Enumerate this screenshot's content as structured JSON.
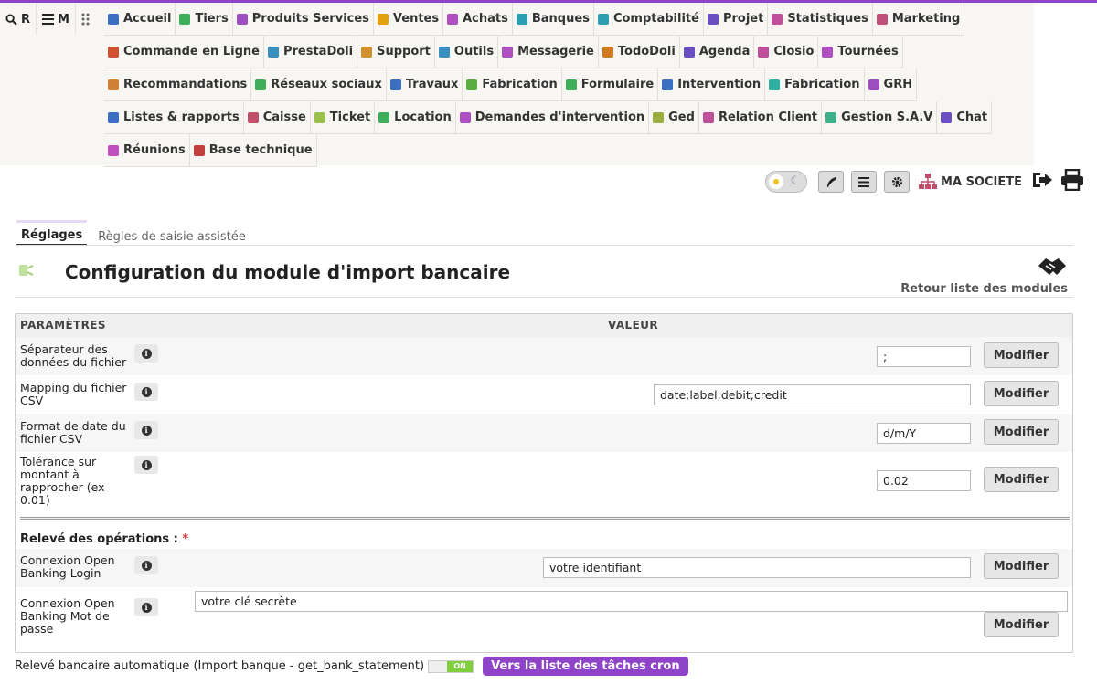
{
  "left_controls": [
    {
      "icon": "search-icon",
      "label": "R"
    },
    {
      "icon": "hamburger-icon",
      "label": "M"
    },
    {
      "icon": "grid-icon",
      "label": ""
    }
  ],
  "menu_rows": [
    [
      {
        "label": "Accueil",
        "icon": "home-icon",
        "color": "#3a6fc1"
      },
      {
        "label": "Tiers",
        "icon": "building-icon",
        "color": "#3fae5a"
      },
      {
        "label": "Produits Services",
        "icon": "cubes-icon",
        "color": "#9b4fc0"
      },
      {
        "label": "Ventes",
        "icon": "euro-icon",
        "color": "#e0a20f"
      },
      {
        "label": "Achats",
        "icon": "coins-icon",
        "color": "#b04fc0"
      },
      {
        "label": "Banques",
        "icon": "bank-icon",
        "color": "#2c9fb0"
      },
      {
        "label": "Comptabilité",
        "icon": "scale-icon",
        "color": "#2c9fb0"
      },
      {
        "label": "Projet",
        "icon": "sitemap-icon",
        "color": "#6a4fc0"
      },
      {
        "label": "Statistiques",
        "icon": "chart-icon",
        "color": "#c04f9b"
      },
      {
        "label": "Marketing",
        "icon": "bullhorn-icon",
        "color": "#c04f7a"
      }
    ],
    [
      {
        "label": "Commande en Ligne",
        "icon": "ban-icon",
        "color": "#d05030"
      },
      {
        "label": "PrestaDoli",
        "icon": "refresh-icon",
        "color": "#3a8fc1"
      },
      {
        "label": "Support",
        "icon": "briefcase-icon",
        "color": "#d09030"
      },
      {
        "label": "Outils",
        "icon": "tools-icon",
        "color": "#3a8fc1"
      },
      {
        "label": "Messagerie",
        "icon": "messages-icon",
        "color": "#b04fc0"
      },
      {
        "label": "TodoDoli",
        "icon": "calendar-check-icon",
        "color": "#d07a20"
      },
      {
        "label": "Agenda",
        "icon": "clock-icon",
        "color": "#6a4fc0"
      },
      {
        "label": "Closio",
        "icon": "target-icon",
        "color": "#c04f9b"
      },
      {
        "label": "Tournées",
        "icon": "route-icon",
        "color": "#b04fc0"
      }
    ],
    [
      {
        "label": "Recommandations",
        "icon": "bullhorn-icon",
        "color": "#d08030"
      },
      {
        "label": "Réseaux sociaux",
        "icon": "broadcast-icon",
        "color": "#3fae5a"
      },
      {
        "label": "Travaux",
        "icon": "road-icon",
        "color": "#3a6fc1"
      },
      {
        "label": "Fabrication",
        "icon": "factory-icon",
        "color": "#5aae3f"
      },
      {
        "label": "Formulaire",
        "icon": "form-icon",
        "color": "#3fae5a"
      },
      {
        "label": "Intervention",
        "icon": "pen-icon",
        "color": "#3a6fc1"
      },
      {
        "label": "Fabrication",
        "icon": "cylinder-icon",
        "color": "#2cb0a0"
      },
      {
        "label": "GRH",
        "icon": "users-icon",
        "color": "#9b4fc0"
      }
    ],
    [
      {
        "label": "Listes & rapports",
        "icon": "table-icon",
        "color": "#3a6fc1"
      },
      {
        "label": "Caisse",
        "icon": "cash-register-icon",
        "color": "#c04f6a"
      },
      {
        "label": "Ticket",
        "icon": "ticket-icon",
        "color": "#9bc04f"
      },
      {
        "label": "Location",
        "icon": "truck-icon",
        "color": "#3fae5a"
      },
      {
        "label": "Demandes d'intervention",
        "icon": "file-plus-icon",
        "color": "#b04fc0"
      },
      {
        "label": "Ged",
        "icon": "folder-icon",
        "color": "#9bae3f"
      },
      {
        "label": "Relation Client",
        "icon": "handshake-icon",
        "color": "#c04f9b"
      },
      {
        "label": "Gestion S.A.V",
        "icon": "handshake-icon",
        "color": "#3fae8a"
      },
      {
        "label": "Chat",
        "icon": "comments-icon",
        "color": "#6a4fc0"
      }
    ],
    [
      {
        "label": "Réunions",
        "icon": "video-icon",
        "color": "#c04fc0"
      },
      {
        "label": "Base technique",
        "icon": "book-icon",
        "color": "#c04040"
      }
    ]
  ],
  "topright": {
    "company": "MA SOCIETE"
  },
  "tabs": {
    "active": "Réglages",
    "other": "Règles de saisie assistée"
  },
  "page": {
    "title": "Configuration du module d'import bancaire",
    "back_link": "Retour liste des modules"
  },
  "table": {
    "col_params": "PARAMÈTRES",
    "col_value": "VALEUR",
    "rows": [
      {
        "label": "Séparateur des données du fichier",
        "value": ";",
        "button": "Modifier"
      },
      {
        "label": "Mapping du fichier CSV",
        "value": "date;label;debit;credit",
        "button": "Modifier"
      },
      {
        "label": "Format de date du fichier CSV",
        "value": "d/m/Y",
        "button": "Modifier"
      },
      {
        "label": "Tolérance sur montant à rapprocher (ex 0.01)",
        "value": "0.02",
        "button": "Modifier"
      }
    ],
    "section_title": "Relevé des opérations :",
    "section_star": "*",
    "rows2": [
      {
        "label": "Connexion Open Banking Login",
        "value": "votre identifiant",
        "button": "Modifier"
      },
      {
        "label": "Connexion Open Banking Mot de passe",
        "value": "votre clé secrète",
        "button": "Modifier"
      }
    ]
  },
  "cron": {
    "label": "Relevé bancaire automatique (Import banque - get_bank_statement)",
    "switch_state": "ON",
    "button": "Vers la liste des tâches cron"
  },
  "colors": {
    "accent": "#8f43c9",
    "switch_on": "#7fcf3f"
  }
}
